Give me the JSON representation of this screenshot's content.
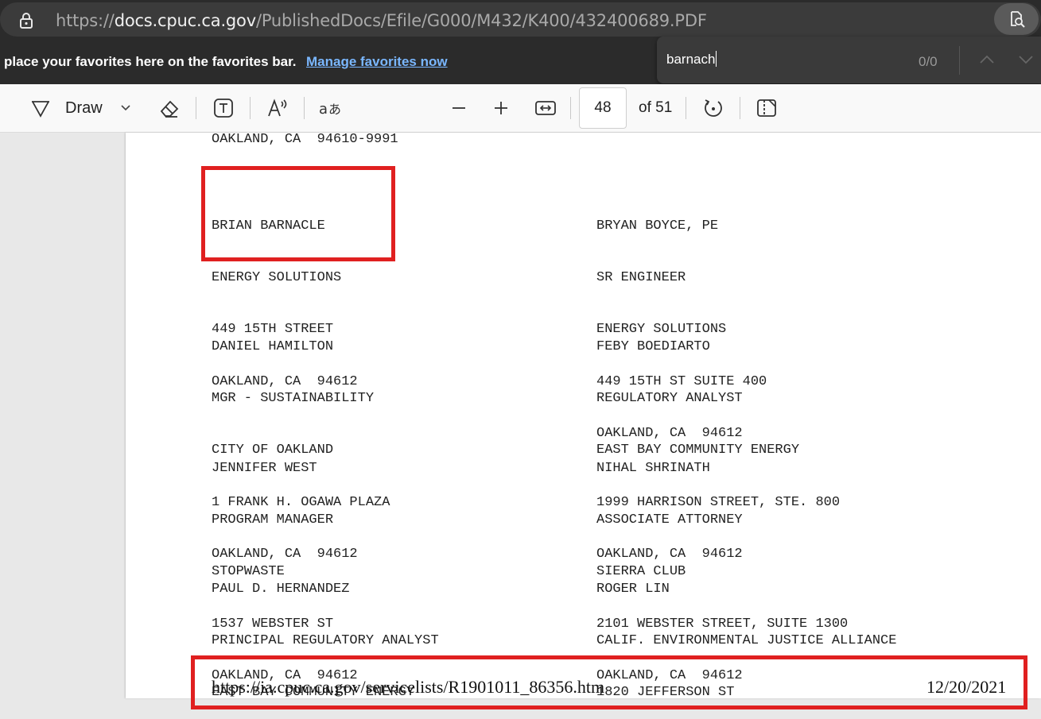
{
  "browser": {
    "url_prefix": "https://",
    "url_host": "docs.cpuc.ca.gov",
    "url_path": "/PublishedDocs/Efile/G000/M432/K400/432400689.PDF",
    "favorites_text": "place your favorites here on the favorites bar.",
    "favorites_link": "Manage favorites now"
  },
  "find": {
    "query": "barnach",
    "count": "0/0"
  },
  "toolbar": {
    "draw_label": "Draw",
    "page_current": "48",
    "page_total": "of 51"
  },
  "document": {
    "top_line": "OAKLAND, CA  94610-9991",
    "left_column": [
      [
        "BRIAN BARNACLE",
        "ENERGY SOLUTIONS",
        "449 15TH STREET",
        "OAKLAND, CA  94612"
      ],
      [
        "DANIEL HAMILTON",
        "MGR - SUSTAINABILITY",
        "CITY OF OAKLAND",
        "1 FRANK H. OGAWA PLAZA",
        "OAKLAND, CA  94612"
      ],
      [
        "JENNIFER WEST",
        "PROGRAM MANAGER",
        "STOPWASTE",
        "1537 WEBSTER ST",
        "OAKLAND, CA  94612"
      ],
      [
        "PAUL D. HERNANDEZ",
        "PRINCIPAL REGULATORY ANALYST",
        "EAST BAY COMMUNITY ENERGY"
      ]
    ],
    "right_column": [
      [
        "BRYAN BOYCE, PE",
        "SR ENGINEER",
        "ENERGY SOLUTIONS",
        "449 15TH ST SUITE 400",
        "OAKLAND, CA  94612"
      ],
      [
        "FEBY BOEDIARTO",
        "REGULATORY ANALYST",
        "EAST BAY COMMUNITY ENERGY",
        "1999 HARRISON STREET, STE. 800",
        "OAKLAND, CA  94612"
      ],
      [
        "NIHAL SHRINATH",
        "ASSOCIATE ATTORNEY",
        "SIERRA CLUB",
        "2101 WEBSTER STREET, SUITE 1300",
        "OAKLAND, CA  94612"
      ],
      [
        "ROGER LIN",
        "CALIF. ENVIRONMENTAL JUSTICE ALLIANCE",
        "1820 JEFFERSON ST"
      ]
    ],
    "footer_url": "https://ia.cpuc.ca.gov/servicelists/R1901011_86356.htm",
    "footer_date": "12/20/2021"
  },
  "colors": {
    "highlight": "#e02020",
    "link": "#7ab7ff"
  }
}
